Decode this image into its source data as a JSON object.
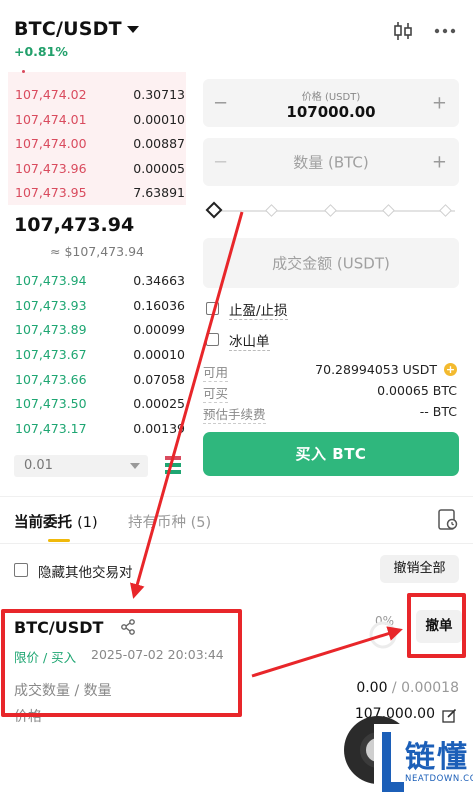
{
  "header": {
    "pair": "BTC/USDT",
    "change": "+0.81%",
    "chart_icon": "candlestick-icon",
    "more_icon": "more-dots-icon"
  },
  "orderbook": {
    "asks": [
      {
        "price": "107,474.02",
        "qty": "0.30713"
      },
      {
        "price": "107,474.01",
        "qty": "0.00010"
      },
      {
        "price": "107,474.00",
        "qty": "0.00887"
      },
      {
        "price": "107,473.96",
        "qty": "0.00005"
      },
      {
        "price": "107,473.95",
        "qty": "7.63891"
      }
    ],
    "last_price": "107,473.94",
    "last_price_usd": "≈ $107,473.94",
    "bids": [
      {
        "price": "107,473.94",
        "qty": "0.34663"
      },
      {
        "price": "107,473.93",
        "qty": "0.16036"
      },
      {
        "price": "107,473.89",
        "qty": "0.00099"
      },
      {
        "price": "107,473.67",
        "qty": "0.00010"
      },
      {
        "price": "107,473.66",
        "qty": "0.07058"
      },
      {
        "price": "107,473.50",
        "qty": "0.00025"
      },
      {
        "price": "107,473.17",
        "qty": "0.00139"
      }
    ],
    "depth": "0.01"
  },
  "form": {
    "price_label": "价格 (USDT)",
    "price_value": "107000.00",
    "qty_placeholder": "数量 (BTC)",
    "amount_placeholder": "成交金额 (USDT)",
    "tp_sl_label": "止盈/止损",
    "iceberg_label": "冰山单",
    "available_label": "可用",
    "available_value": "70.28994053 USDT",
    "buyable_label": "可买",
    "buyable_value": "0.00065 BTC",
    "fee_label": "预估手续费",
    "fee_value": "-- BTC",
    "buy_button": "买入 BTC",
    "minus": "−",
    "plus": "+",
    "coin_badge": "+"
  },
  "tabs": {
    "open_orders": "当前委托",
    "open_orders_count": "(1)",
    "holdings": "持有币种",
    "holdings_count": "(5)",
    "hide_others": "隐藏其他交易对",
    "cancel_all": "撤销全部"
  },
  "order": {
    "pair": "BTC/USDT",
    "type": "限价 / 买入",
    "time": "2025-07-02 20:03:44",
    "progress": "0%",
    "cancel": "撤单",
    "filled_label": "成交数量 / 数量",
    "filled": "0.00",
    "amount": " / 0.00018",
    "price_label": "价格",
    "price": "107,000.00"
  },
  "watermark": {
    "text": "链懂",
    "url": "NEATDOWN.COM"
  },
  "colors": {
    "up": "#1ea672",
    "down": "#d94b5e",
    "buy": "#2fb77d",
    "accent": "#f0b90b",
    "annotation": "#e8262a"
  }
}
